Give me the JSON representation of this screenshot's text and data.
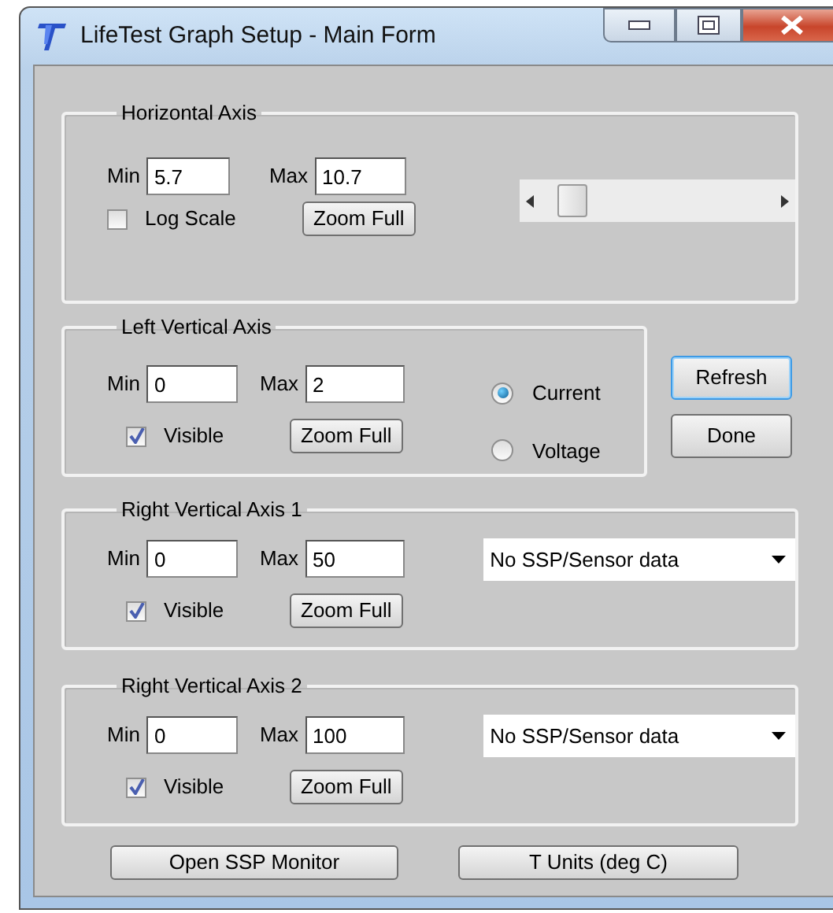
{
  "window": {
    "title": "LifeTest Graph Setup - Main Form"
  },
  "horizontal_axis": {
    "title": "Horizontal Axis",
    "min_label": "Min",
    "min": "5.7",
    "max_label": "Max",
    "max": "10.7",
    "log_scale": {
      "label": "Log Scale",
      "checked": false
    },
    "zoom_button": "Zoom Full"
  },
  "left_vertical_axis": {
    "title": "Left Vertical Axis",
    "min_label": "Min",
    "min": "0",
    "max_label": "Max",
    "max": "2",
    "visible": {
      "label": "Visible",
      "checked": true
    },
    "zoom_button": "Zoom Full",
    "quantity": [
      {
        "label": "Current",
        "selected": true
      },
      {
        "label": "Voltage",
        "selected": false
      }
    ]
  },
  "side_buttons": [
    {
      "label": "Refresh",
      "focused": true
    },
    {
      "label": "Done",
      "focused": false
    }
  ],
  "right_vertical_axes": [
    {
      "title": "Right Vertical Axis 1",
      "min_label": "Min",
      "min": "0",
      "max_label": "Max",
      "max": "50",
      "visible": {
        "label": "Visible",
        "checked": true
      },
      "zoom_button": "Zoom Full",
      "source": "No SSP/Sensor data"
    },
    {
      "title": "Right Vertical Axis 2",
      "min_label": "Min",
      "min": "0",
      "max_label": "Max",
      "max": "100",
      "visible": {
        "label": "Visible",
        "checked": true
      },
      "zoom_button": "Zoom Full",
      "source": "No SSP/Sensor data"
    }
  ],
  "bottom_buttons": [
    "Open SSP Monitor",
    "T Units (deg C)"
  ]
}
